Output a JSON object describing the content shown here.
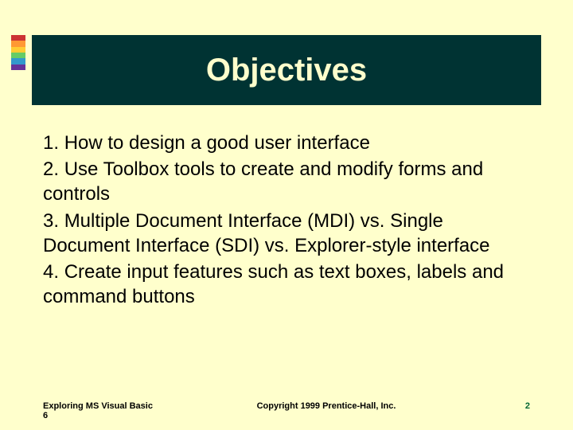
{
  "accent_colors": [
    "#cc3333",
    "#ff9933",
    "#ffcc33",
    "#66cc66",
    "#3399cc",
    "#663399"
  ],
  "title": "Objectives",
  "items": [
    {
      "num": "1.",
      "text": "How to design a good user interface"
    },
    {
      "num": "2.",
      "text": "Use Toolbox tools to create and modify forms and controls"
    },
    {
      "num": "3.",
      "text": "Multiple Document Interface (MDI) vs. Single Document Interface (SDI) vs. Explorer-style interface"
    },
    {
      "num": "4.",
      "text": "Create input features such as text boxes, labels and command buttons"
    }
  ],
  "footer": {
    "left": "Exploring MS Visual Basic 6",
    "center": "Copyright 1999 Prentice-Hall, Inc.",
    "right": "2"
  }
}
